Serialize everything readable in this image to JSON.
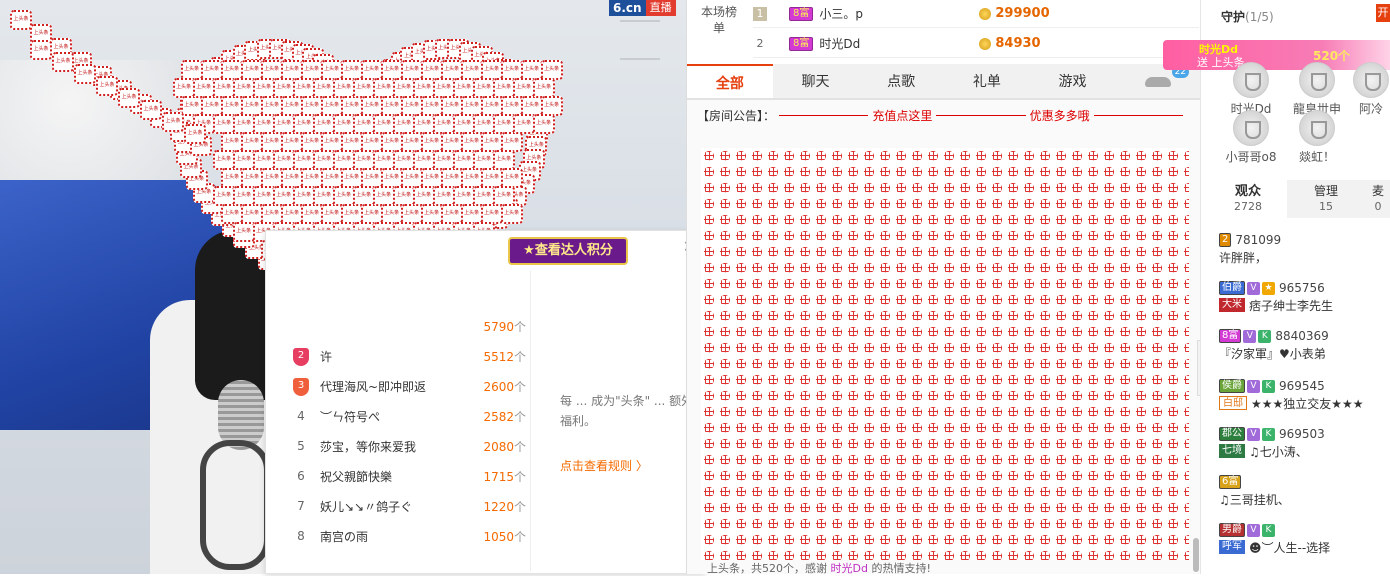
{
  "video": {
    "logo_text": "6.cn",
    "live_badge": "直播",
    "sign_text": "上头条"
  },
  "rank_popup": {
    "view_button": "★查看达人积分",
    "rows": [
      {
        "rank": "",
        "name": "",
        "count": "5790",
        "unit": "个"
      },
      {
        "rank": "2",
        "name": "许",
        "count": "5512",
        "unit": "个"
      },
      {
        "rank": "3",
        "name": "代理海风~即冲即返",
        "count": "2600",
        "unit": "个"
      },
      {
        "rank": "4",
        "name": "︶ㄣ符号ぺ",
        "count": "2582",
        "unit": "个"
      },
      {
        "rank": "5",
        "name": "莎宝，等你来爱我",
        "count": "2080",
        "unit": "个"
      },
      {
        "rank": "6",
        "name": "祝父親節快樂",
        "count": "1715",
        "unit": "个"
      },
      {
        "rank": "7",
        "name": "妖儿↘↘〃鸽子ぐ",
        "count": "1220",
        "unit": "个"
      },
      {
        "rank": "8",
        "name": "南宫の雨",
        "count": "1050",
        "unit": "个"
      }
    ],
    "rule_text": "每 ... 成为\"头条\" ... 额外福利。",
    "rule_link": "点击查看规则 〉",
    "close": "✕"
  },
  "top_board": {
    "title": "本场榜单",
    "rows": [
      {
        "no": "1",
        "tag": "8富",
        "name": "小三。p",
        "amount": "299900"
      },
      {
        "no": "2",
        "tag": "8富",
        "name": "时光Dd",
        "amount": "84930"
      }
    ]
  },
  "chat_tabs": [
    {
      "label": "全部",
      "active": true
    },
    {
      "label": "聊天"
    },
    {
      "label": "点歌"
    },
    {
      "label": "礼单"
    },
    {
      "label": "游戏"
    }
  ],
  "car_count": "22",
  "notice": {
    "label": "【房间公告】：",
    "left": "充值点这里",
    "right": "优惠多多哦"
  },
  "bottom_msg": {
    "prefix": "上头条，共520个，感谢",
    "user": "时光Dd",
    "suffix": "的热情支持!"
  },
  "guard": {
    "title": "守护",
    "count": "(1/5)",
    "open_label": "开",
    "banner": {
      "name": "时光Dd",
      "sub": "送 上头条",
      "num": "520个"
    },
    "members": [
      "时光Dd",
      "龍皇丗申",
      "阿冷",
      "小哥哥o8",
      "燚虹！"
    ]
  },
  "audience_tabs": [
    {
      "label": "观众",
      "count": "2728",
      "active": true
    },
    {
      "label": "管理",
      "count": "15"
    },
    {
      "label": "麦",
      "count": "0"
    }
  ],
  "audience": [
    {
      "title": "2",
      "id": "781099",
      "tag": "",
      "name": "许胖胖，"
    },
    {
      "title": "伯爵",
      "id": "965756",
      "tag": "大米",
      "name": "痞子绅士李先生"
    },
    {
      "title": "8富",
      "id": "8840369",
      "tag": "",
      "name": "『汐家軍』♥小表弟"
    },
    {
      "title": "侯爵",
      "id": "969545",
      "tag": "白邸",
      "name": "★★★独立交友★★★"
    },
    {
      "title": "郡公",
      "id": "969503",
      "tag": "七境",
      "name": "♫七小涛、"
    },
    {
      "title": "6富",
      "id": "",
      "tag": "",
      "name": "♫三哥挂机、"
    },
    {
      "title": "男爵",
      "id": "",
      "tag": "呼军",
      "name": "☻︶人生--选择"
    }
  ],
  "colors": {
    "accent": "#e6400f",
    "amount": "#e56600",
    "purple": "#c230c2"
  }
}
